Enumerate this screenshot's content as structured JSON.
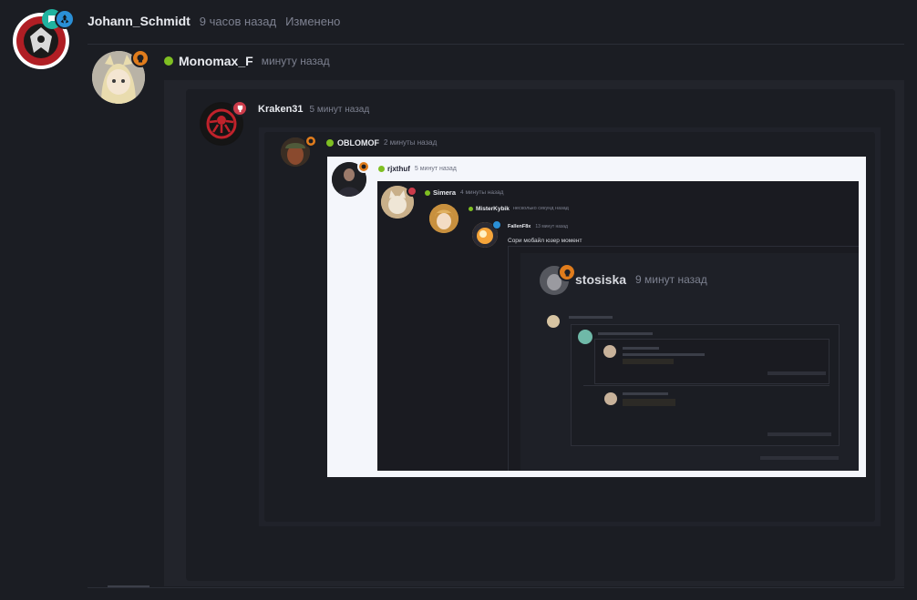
{
  "colors": {
    "page_bg": "#1b1d23",
    "quote_bg": "#20222a",
    "online": "#7fbf22",
    "badge_orange": "#e07c1c",
    "badge_red": "#cc3b4a",
    "badge_blue": "#2a8fd6",
    "badge_teal": "#21b3a0",
    "screenshot_frame": "#f4f6fb"
  },
  "top_comment": {
    "author": "Johann_Schmidt",
    "time": "9 часов назад",
    "edited": "Изменено",
    "avatar_icon": "shield-logo-icon",
    "badges": [
      "chat-badge-icon",
      "radiation-badge-icon"
    ]
  },
  "reply": {
    "author": "Monomax_F",
    "time": "минуту назад",
    "badge": "skull-badge-icon"
  },
  "quote_level1": {
    "author": "Kraken31",
    "time": "5 минут назад",
    "badge": "trophy-badge-icon"
  },
  "quote_level2": {
    "author": "OBLOMOF",
    "time": "2 минуты назад",
    "badge": "skull-badge-icon"
  },
  "quote_level3": {
    "author": "rjxthuf",
    "time": "5 минут назад",
    "badge": "skull-badge-icon"
  },
  "quote_level4": {
    "author": "Simera",
    "time": "4 минуты назад",
    "badge": "trophy-badge-icon"
  },
  "quote_level5": {
    "author": "MisterKybik",
    "time": "несколько секунд назад"
  },
  "quote_level6": {
    "author": "FallenF8x",
    "time": "13 минут назад",
    "text": "Сори мобайл юзер момент"
  },
  "quote_level7": {
    "author": "stosiska",
    "time": "9 минут назад",
    "badge": "skull-badge-icon"
  }
}
